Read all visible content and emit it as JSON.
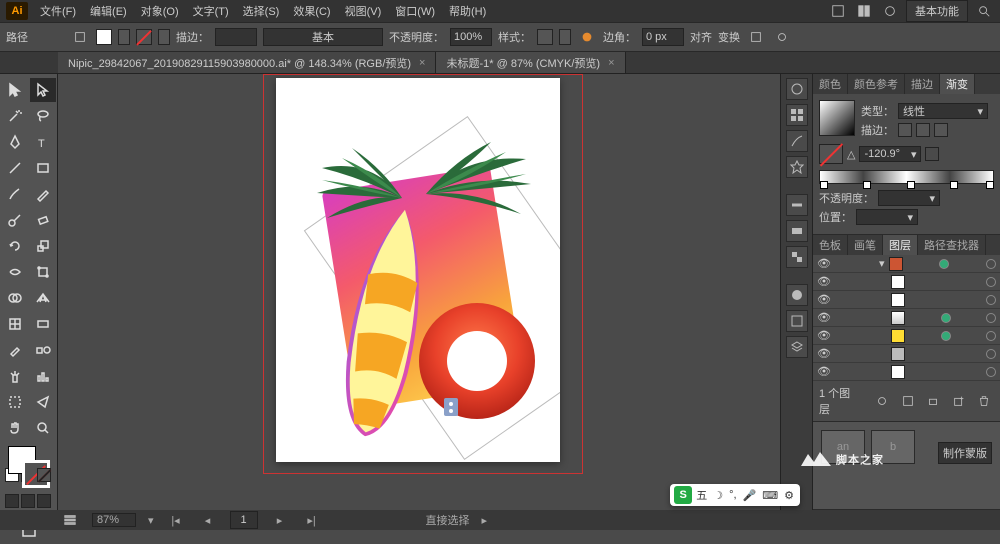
{
  "titlebar": {
    "logo": "Ai",
    "menus": [
      "文件(F)",
      "编辑(E)",
      "对象(O)",
      "文字(T)",
      "选择(S)",
      "效果(C)",
      "视图(V)",
      "窗口(W)",
      "帮助(H)"
    ],
    "workspace": "基本功能"
  },
  "controlbar": {
    "pathLabel": "路径",
    "strokeLabel": "描边：",
    "basic": "基本",
    "opacityLabel": "不透明度：",
    "opacity": "100%",
    "styleLabel": "样式：",
    "cornerLabel": "边角：",
    "cornerValue": "0 px",
    "alignLabel": "对齐",
    "transformLabel": "变换"
  },
  "tabs": [
    {
      "label": "Nipic_29842067_20190829115903980000.ai* @ 148.34% (RGB/预览)",
      "active": false
    },
    {
      "label": "未标题-1* @ 87% (CMYK/预览)",
      "active": true
    }
  ],
  "gradientPanel": {
    "tabs": [
      "颜色",
      "颜色参考",
      "描边",
      "渐变"
    ],
    "typeLabel": "类型：",
    "type": "线性",
    "strokeLabel": "描边：",
    "angleLabel": "△",
    "angle": "-120.9°",
    "opacityLabel": "不透明度：",
    "posLabel": "位置："
  },
  "layersPanel": {
    "tabs": [
      "色板",
      "画笔",
      "图层",
      "路径查找器"
    ],
    "rows": [
      {
        "thumb": "#c53",
        "sel": true
      },
      {
        "thumb": "#fff",
        "sel": false
      },
      {
        "thumb": "#fff",
        "sel": false
      },
      {
        "thumb": "#d8d",
        "sel": false
      },
      {
        "thumb": "#fd3",
        "sel": true
      },
      {
        "thumb": "#ccc",
        "sel": false
      },
      {
        "thumb": "#fff",
        "sel": false
      }
    ],
    "countLabel": "1 个图层",
    "makeMask": "制作蒙版"
  },
  "statusbar": {
    "zoom": "87%",
    "label": "直接选择"
  },
  "ime": {
    "badge": "S",
    "mode": "五",
    "moon": "☽",
    "target": "◎",
    "mic": "🎤"
  },
  "watermark": "脚本之家"
}
